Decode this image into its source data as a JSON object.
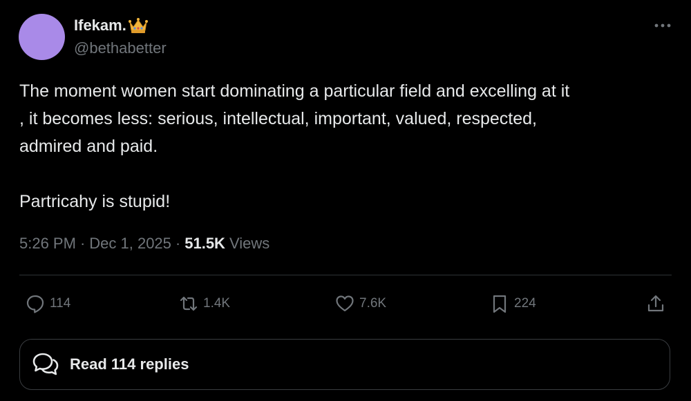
{
  "author": {
    "display_name": "Ifekam.",
    "badge_icon": "crown-icon",
    "handle": "@bethabetter",
    "avatar_color": "#a98ae8"
  },
  "tweet": {
    "text": "The moment women start dominating a particular field and excelling at it\n, it becomes less: serious, intellectual, important, valued, respected,\nadmired and paid.\n\nPartricahy is stupid!",
    "time": "5:26 PM",
    "date": "Dec 1, 2025",
    "views_count": "51.5K",
    "views_label": "Views"
  },
  "actions": {
    "replies": "114",
    "reposts": "1.4K",
    "likes": "7.6K",
    "bookmarks": "224"
  },
  "replies_button": {
    "label": "Read 114 replies"
  },
  "colors": {
    "background": "#000000",
    "text": "#e7e9ea",
    "muted": "#71767b",
    "border": "#2f3336"
  }
}
